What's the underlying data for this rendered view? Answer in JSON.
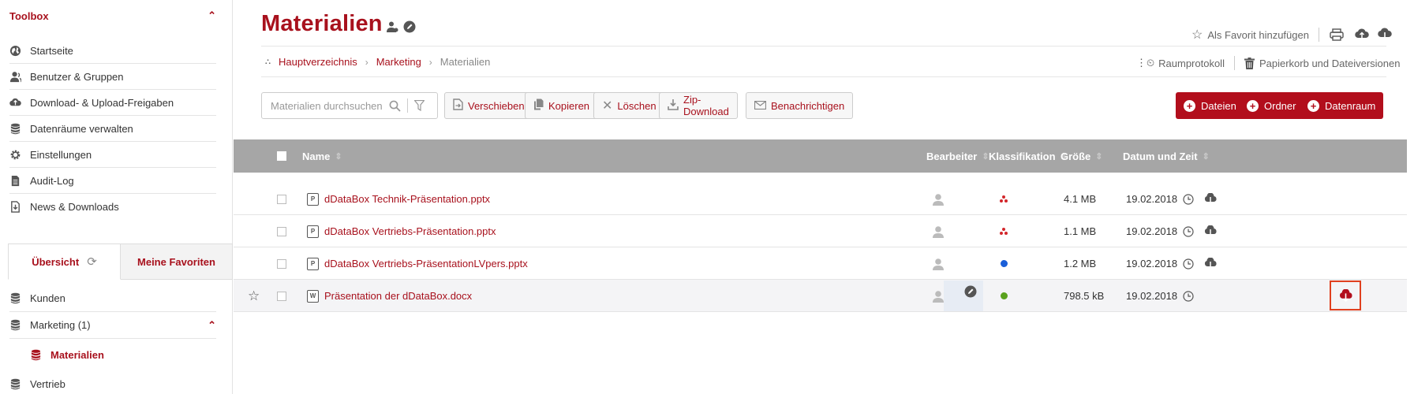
{
  "sidebar": {
    "toolbox_title": "Toolbox",
    "nav": [
      {
        "label": "Startseite",
        "icon": "globe-icon"
      },
      {
        "label": "Benutzer & Gruppen",
        "icon": "users-icon"
      },
      {
        "label": "Download- & Upload-Freigaben",
        "icon": "cloud-share-icon"
      },
      {
        "label": "Datenräume verwalten",
        "icon": "database-icon"
      },
      {
        "label": "Einstellungen",
        "icon": "gear-icon"
      },
      {
        "label": "Audit-Log",
        "icon": "document-icon"
      },
      {
        "label": "News & Downloads",
        "icon": "download-file-icon"
      }
    ],
    "tabs": {
      "overview": "Übersicht",
      "favorites": "Meine Favoriten"
    },
    "tree": [
      {
        "label": "Kunden"
      },
      {
        "label": "Marketing (1)"
      },
      {
        "label": "Materialien"
      },
      {
        "label": "Vertrieb"
      }
    ]
  },
  "header": {
    "title": "Materialien",
    "favorite_label": "Als Favorit hinzufügen",
    "room_protocol": "Raumprotokoll",
    "trash_label": "Papierkorb und Dateiversionen"
  },
  "breadcrumb": {
    "root": "Hauptverzeichnis",
    "parent": "Marketing",
    "current": "Materialien"
  },
  "toolbar": {
    "search_placeholder": "Materialien durchsuchen",
    "move": "Verschieben",
    "copy": "Kopieren",
    "delete": "Löschen",
    "zip": "Zip-Download",
    "notify": "Benachrichtigen",
    "files": "Dateien",
    "folder": "Ordner",
    "dataroom": "Datenraum"
  },
  "table": {
    "headers": {
      "name": "Name",
      "editor": "Bearbeiter",
      "classification": "Klassifikation",
      "size": "Größe",
      "datetime": "Datum und Zeit"
    },
    "rows": [
      {
        "type": "P",
        "name": "dDataBox Technik-Präsentation.pptx",
        "classification": "red-cluster",
        "size": "4.1 MB",
        "date": "19.02.2018"
      },
      {
        "type": "P",
        "name": "dDataBox Vertriebs-Präsentation.pptx",
        "classification": "red-cluster",
        "size": "1.1 MB",
        "date": "19.02.2018"
      },
      {
        "type": "P",
        "name": "dDataBox Vertriebs-PräsentationLVpers.pptx",
        "classification": "blue",
        "size": "1.2 MB",
        "date": "19.02.2018"
      },
      {
        "type": "W",
        "name": "Präsentation der dDataBox.docx",
        "classification": "green",
        "size": "798.5 kB",
        "date": "19.02.2018"
      }
    ]
  },
  "colors": {
    "accent": "#a8111d",
    "button_red": "#b20e1c",
    "header_gray": "#a6a6a6",
    "class_blue": "#1a5fd9",
    "class_green": "#5aa21e",
    "highlight_border": "#e0401f"
  }
}
